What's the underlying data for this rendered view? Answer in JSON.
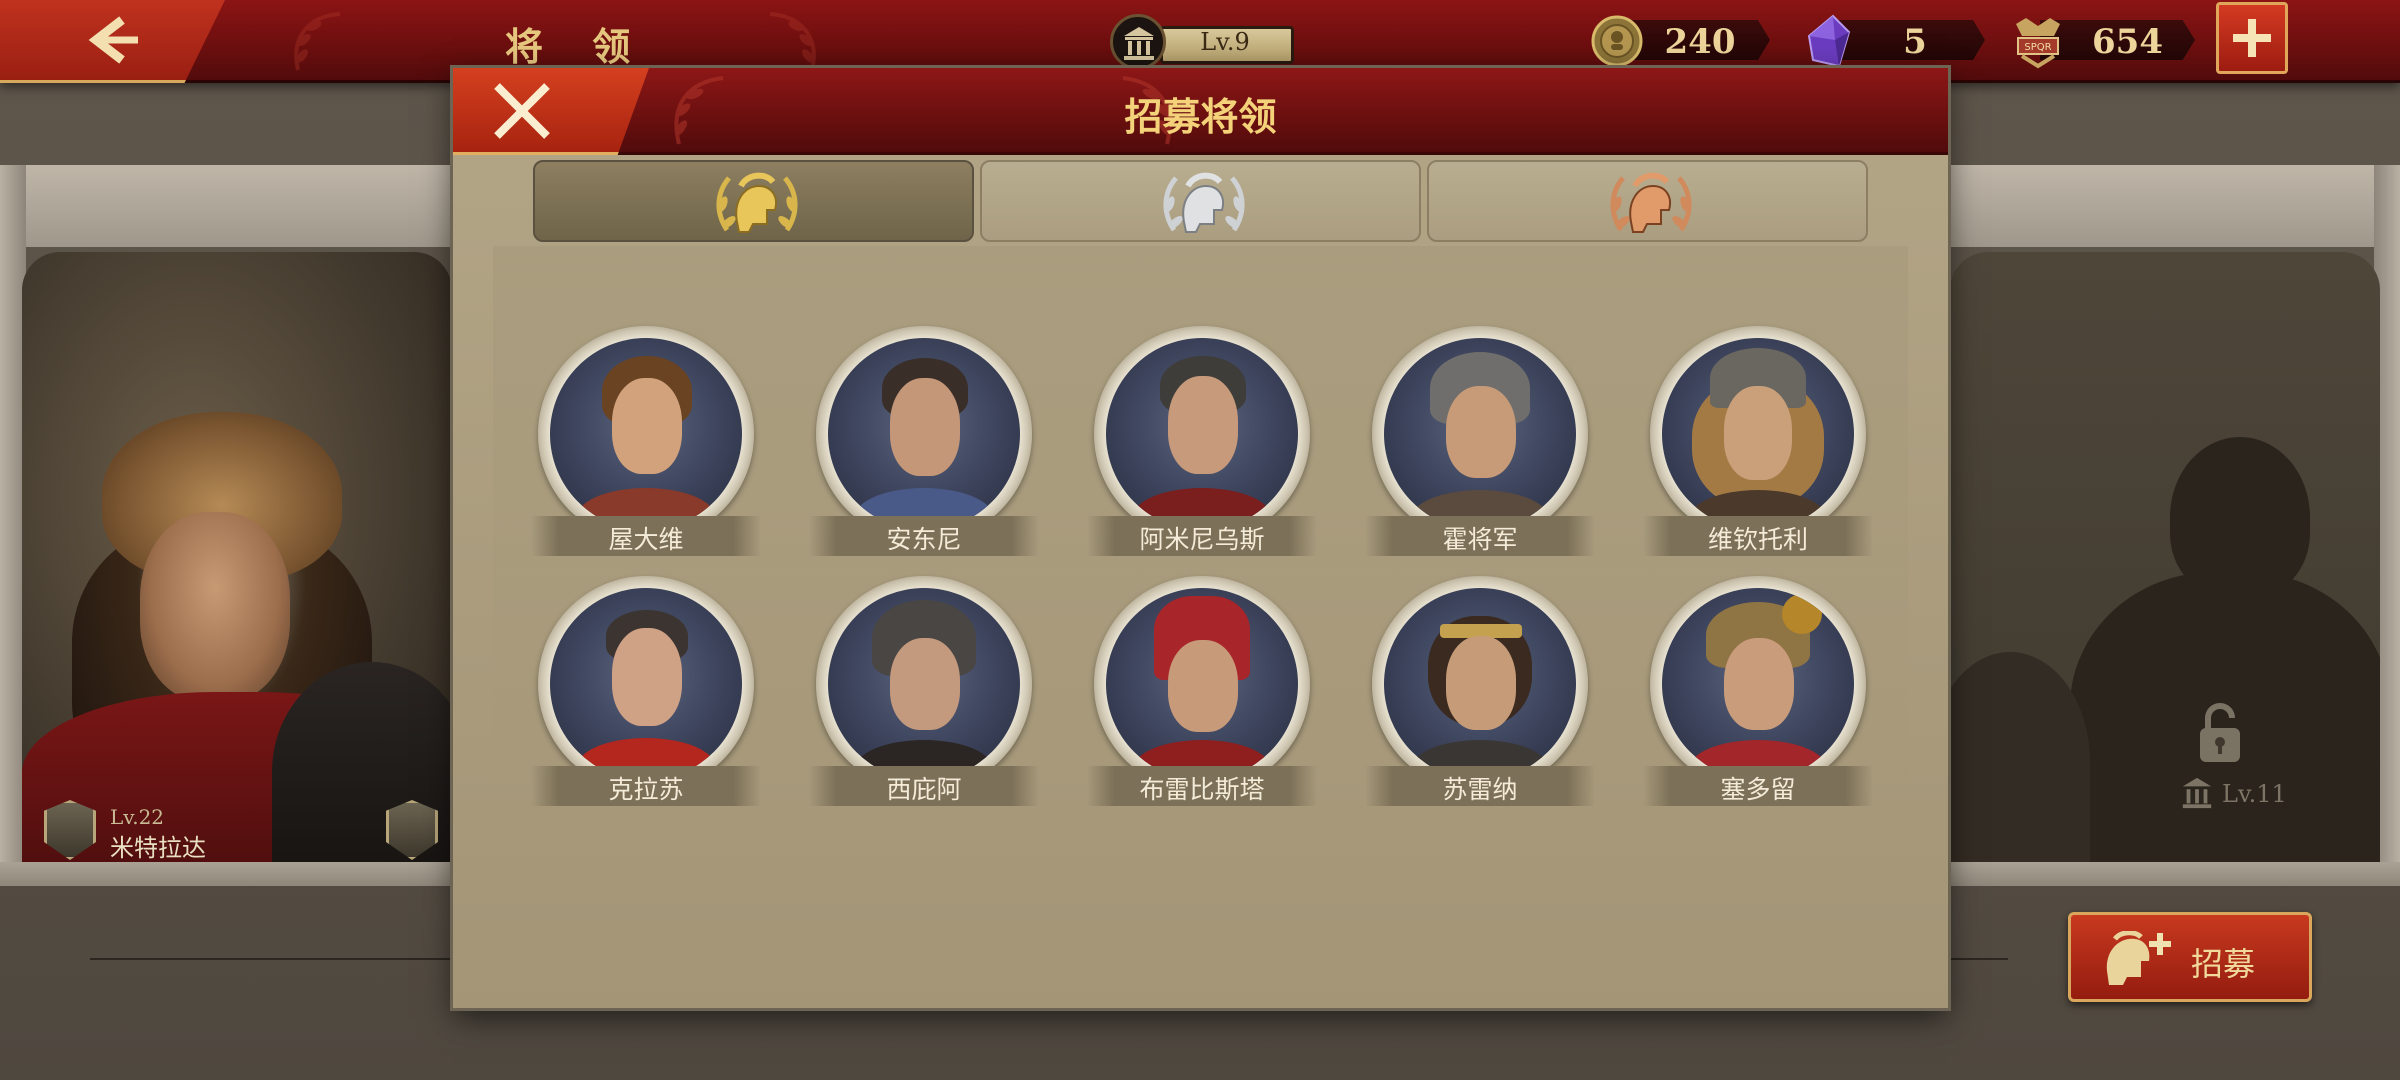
{
  "topbar": {
    "title": "将 领",
    "level": "Lv.9",
    "resources": [
      {
        "icon": "coin-icon",
        "value": "240"
      },
      {
        "icon": "purple-gem-icon",
        "value": "5"
      },
      {
        "icon": "spqr-emblem-icon",
        "value": "654"
      }
    ]
  },
  "modal": {
    "title": "招募将领",
    "tabs": [
      {
        "tier": "gold",
        "icon": "gold-helmet-laurel-icon",
        "active": true
      },
      {
        "tier": "silver",
        "icon": "silver-helmet-laurel-icon",
        "active": false
      },
      {
        "tier": "bronze",
        "icon": "bronze-helmet-laurel-icon",
        "active": false
      }
    ],
    "heroes": [
      {
        "name": "屋大维"
      },
      {
        "name": "安东尼"
      },
      {
        "name": "阿米尼乌斯"
      },
      {
        "name": "霍将军"
      },
      {
        "name": "维钦托利"
      },
      {
        "name": "克拉苏"
      },
      {
        "name": "西庇阿"
      },
      {
        "name": "布雷比斯塔"
      },
      {
        "name": "苏雷纳"
      },
      {
        "name": "塞多留"
      }
    ]
  },
  "background": {
    "left_general": {
      "level": "Lv.22",
      "name": "米特拉达"
    },
    "right_slot": {
      "unlock_level": "Lv.11"
    },
    "recruit_button": "招募"
  },
  "colors": {
    "header_red": "#7a1212",
    "accent_gold": "#e6c77e",
    "parchment": "#ab9e80"
  }
}
